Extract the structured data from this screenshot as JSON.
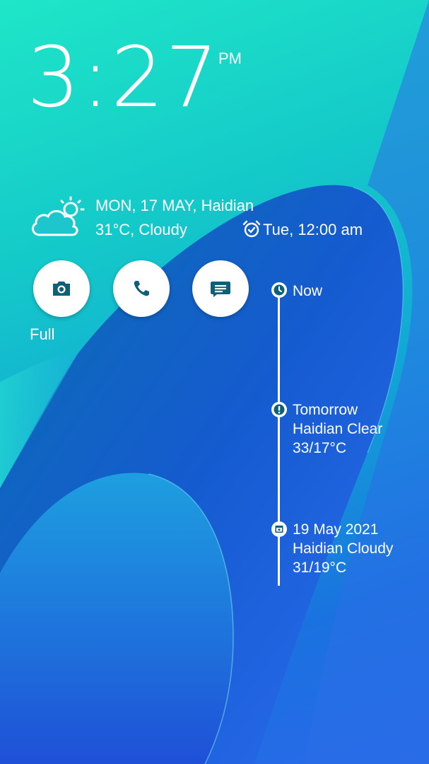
{
  "lockscreen": {
    "time": "3:27",
    "ampm": "PM",
    "weather": {
      "icon": "partly-cloudy-icon",
      "date_location": "MON, 17 MAY, Haidian",
      "temp_condition": "31°C, Cloudy"
    },
    "alarm": {
      "icon": "alarm-clock-icon",
      "text": "Tue, 12:00 am"
    },
    "shortcuts": [
      {
        "icon": "camera-icon"
      },
      {
        "icon": "phone-icon"
      },
      {
        "icon": "message-icon"
      }
    ],
    "full_label": "Full",
    "timeline": [
      {
        "icon": "clock-icon",
        "title": "Now"
      },
      {
        "icon": "alert-icon",
        "title": "Tomorrow",
        "line1": "Haidian Clear",
        "line2": "33/17°C"
      },
      {
        "icon": "calendar-icon",
        "title": "19 May 2021",
        "line1": "Haidian Cloudy",
        "line2": "31/19°C"
      }
    ]
  },
  "colors": {
    "accent_teal": "#1fe6c8",
    "accent_blue": "#2a68ea",
    "icon_dark": "#0e5f78",
    "text": "#ffffff"
  }
}
